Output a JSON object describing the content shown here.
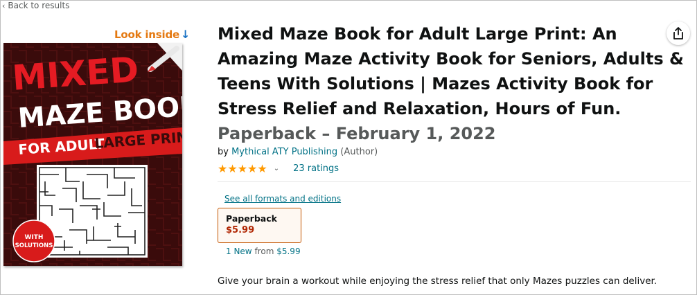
{
  "nav": {
    "back_label": "Back to results"
  },
  "cover": {
    "look_inside": "Look inside",
    "line1": "MIXED",
    "line2": "MAZE BOOK",
    "banner_a": "FOR ADULT",
    "banner_b": "LARGE PRINT",
    "badge_top": "WITH",
    "badge_bottom": "SOLUTIONS"
  },
  "product": {
    "title": "Mixed Maze Book for Adult Large Print: An Amazing Maze Activity Book for Seniors, Adults & Teens With Solutions | Mazes Activity Book for Stress Relief and Relaxation, Hours of Fun.",
    "format_date": "Paperback – February 1, 2022",
    "by": "by",
    "author": "Mythical ATY Publishing",
    "author_role": "(Author)",
    "rating_stars": 5,
    "ratings_count": "23 ratings"
  },
  "formats": {
    "see_all": "See all formats and editions",
    "selected_name": "Paperback",
    "selected_price": "$5.99"
  },
  "offers": {
    "new_count": "1 New",
    "from_label": "from",
    "from_price": "$5.99"
  },
  "description": "Give your brain a workout while enjoying the stress relief that only Mazes puzzles can deliver.",
  "colors": {
    "link": "#007185",
    "price": "#b12704",
    "star": "#ff9900",
    "look_inside": "#e47911"
  }
}
